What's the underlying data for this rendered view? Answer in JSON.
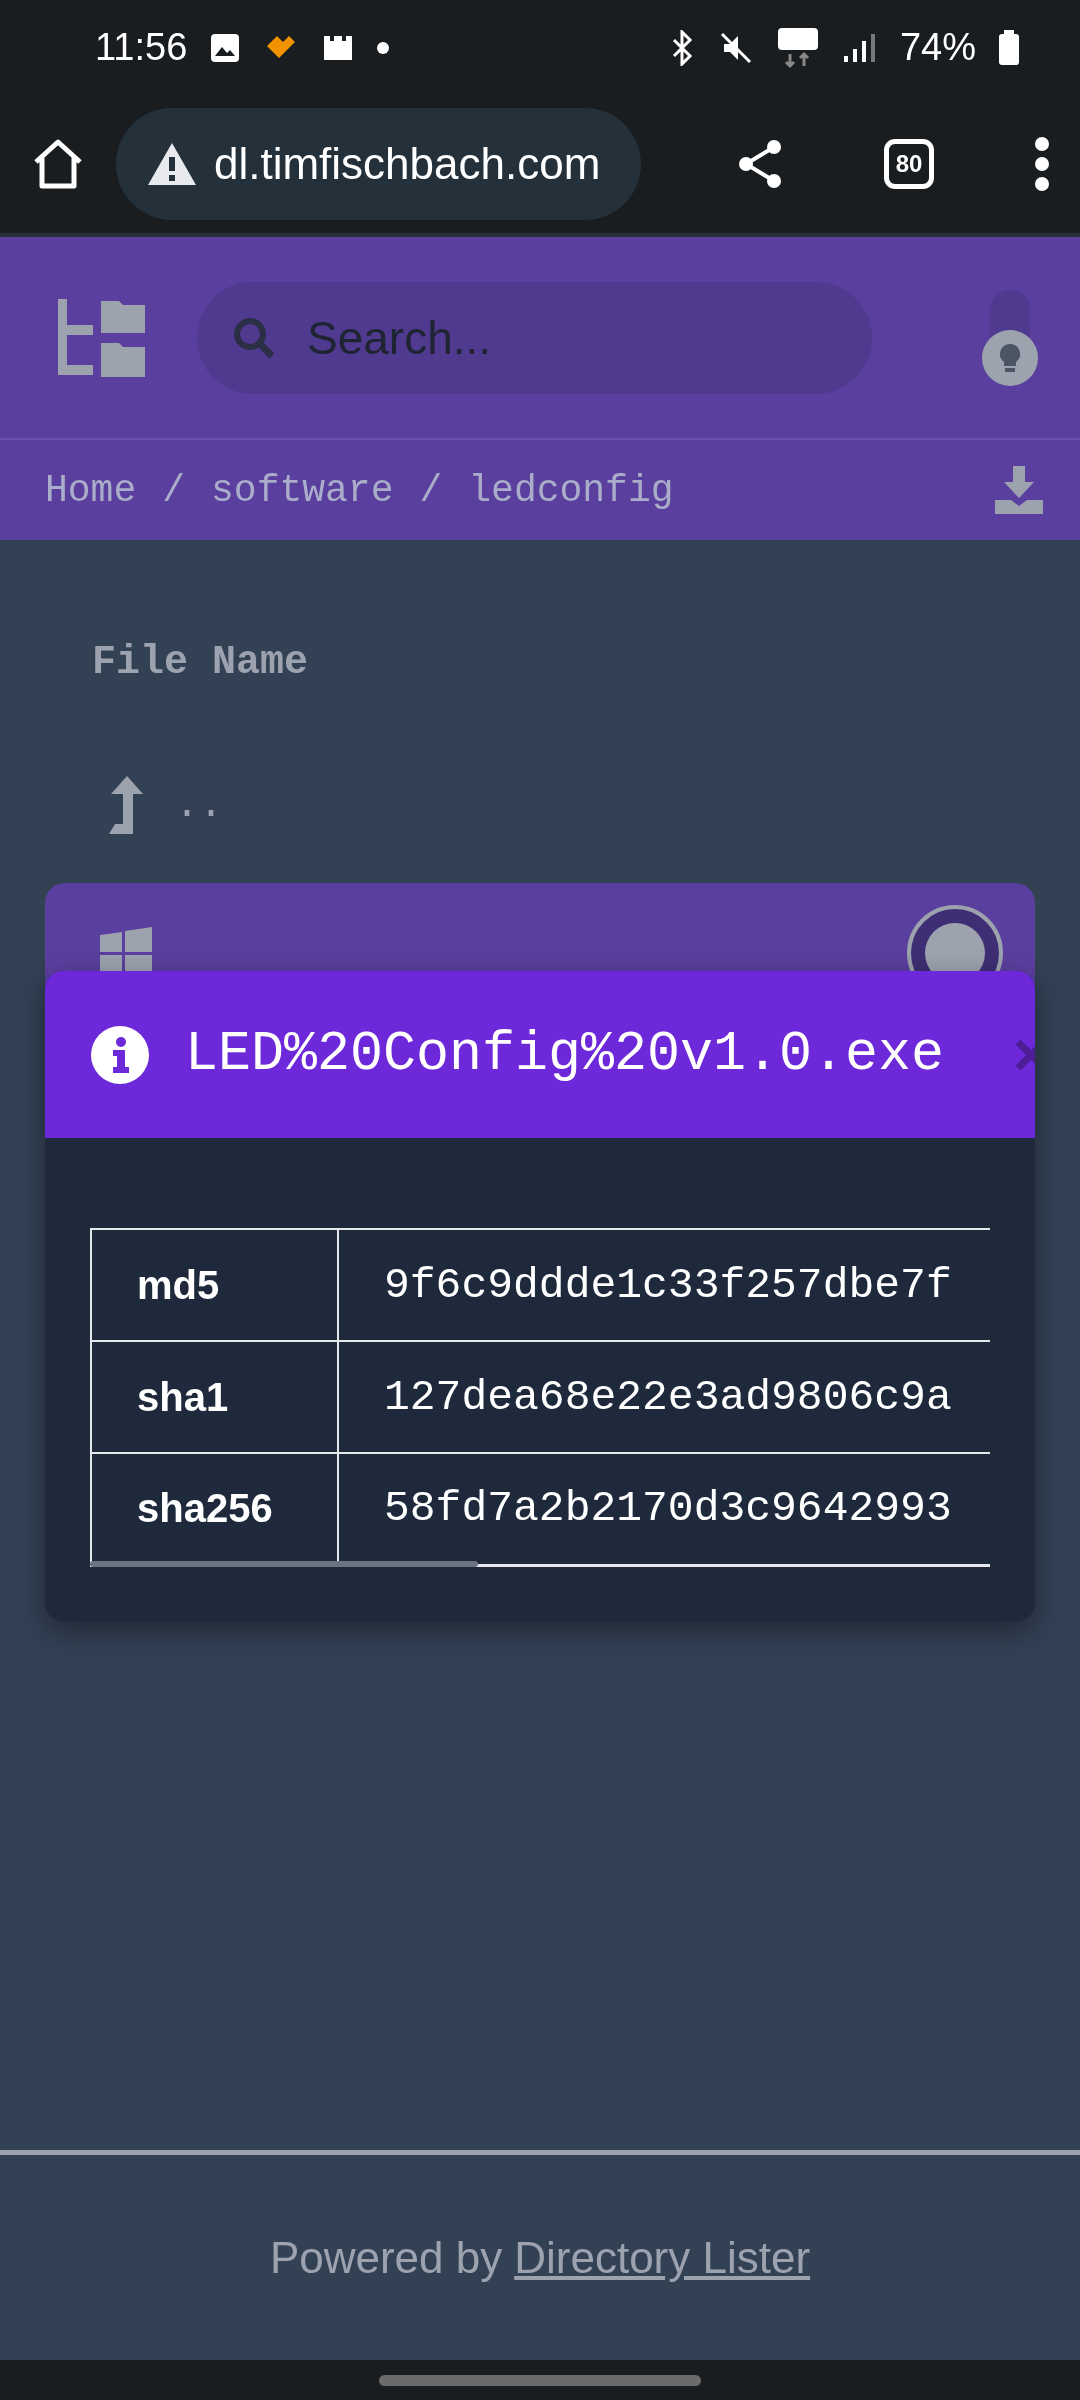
{
  "status_bar": {
    "time": "11:56",
    "battery": "74%"
  },
  "browser": {
    "url": "dl.timfischbach.com",
    "tab_count": "80"
  },
  "header": {
    "search": {
      "placeholder": "Search..."
    }
  },
  "breadcrumbs": [
    {
      "label": "Home"
    },
    {
      "label": "software"
    },
    {
      "label": "ledconfig"
    }
  ],
  "breadcrumb_separator": "/",
  "listing": {
    "column_header": "File Name",
    "parent_link": ".."
  },
  "modal": {
    "title": "LED%20Config%20v1.0.exe",
    "hashes": [
      {
        "name": "md5",
        "value": "9f6c9ddde1c33f257dbe7f"
      },
      {
        "name": "sha1",
        "value": "127dea68e22e3ad9806c9a"
      },
      {
        "name": "sha256",
        "value": "58fd7a2b2170d3c9642993"
      }
    ]
  },
  "footer": {
    "text": "Powered by",
    "link": "Directory Lister"
  }
}
